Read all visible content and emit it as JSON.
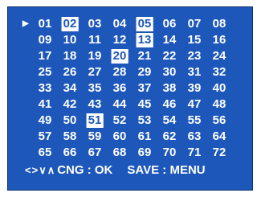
{
  "cursor_glyph": "▶",
  "channels": [
    {
      "label": "01",
      "selected": false,
      "cursor": true
    },
    {
      "label": "02",
      "selected": true
    },
    {
      "label": "03",
      "selected": false
    },
    {
      "label": "04",
      "selected": false
    },
    {
      "label": "05",
      "selected": true
    },
    {
      "label": "06",
      "selected": false
    },
    {
      "label": "07",
      "selected": false
    },
    {
      "label": "08",
      "selected": false
    },
    {
      "label": "09",
      "selected": false
    },
    {
      "label": "10",
      "selected": false
    },
    {
      "label": "11",
      "selected": false
    },
    {
      "label": "12",
      "selected": false
    },
    {
      "label": "13",
      "selected": true
    },
    {
      "label": "14",
      "selected": false
    },
    {
      "label": "15",
      "selected": false
    },
    {
      "label": "16",
      "selected": false
    },
    {
      "label": "17",
      "selected": false
    },
    {
      "label": "18",
      "selected": false
    },
    {
      "label": "19",
      "selected": false
    },
    {
      "label": "20",
      "selected": true
    },
    {
      "label": "21",
      "selected": false
    },
    {
      "label": "22",
      "selected": false
    },
    {
      "label": "23",
      "selected": false
    },
    {
      "label": "24",
      "selected": false
    },
    {
      "label": "25",
      "selected": false
    },
    {
      "label": "26",
      "selected": false
    },
    {
      "label": "27",
      "selected": false
    },
    {
      "label": "28",
      "selected": false
    },
    {
      "label": "29",
      "selected": false
    },
    {
      "label": "30",
      "selected": false
    },
    {
      "label": "31",
      "selected": false
    },
    {
      "label": "32",
      "selected": false
    },
    {
      "label": "33",
      "selected": false
    },
    {
      "label": "34",
      "selected": false
    },
    {
      "label": "35",
      "selected": false
    },
    {
      "label": "36",
      "selected": false
    },
    {
      "label": "37",
      "selected": false
    },
    {
      "label": "38",
      "selected": false
    },
    {
      "label": "39",
      "selected": false
    },
    {
      "label": "40",
      "selected": false
    },
    {
      "label": "41",
      "selected": false
    },
    {
      "label": "42",
      "selected": false
    },
    {
      "label": "43",
      "selected": false
    },
    {
      "label": "44",
      "selected": false
    },
    {
      "label": "45",
      "selected": false
    },
    {
      "label": "46",
      "selected": false
    },
    {
      "label": "47",
      "selected": false
    },
    {
      "label": "48",
      "selected": false
    },
    {
      "label": "49",
      "selected": false
    },
    {
      "label": "50",
      "selected": false
    },
    {
      "label": "51",
      "selected": true
    },
    {
      "label": "52",
      "selected": false
    },
    {
      "label": "53",
      "selected": false
    },
    {
      "label": "54",
      "selected": false
    },
    {
      "label": "55",
      "selected": false
    },
    {
      "label": "56",
      "selected": false
    },
    {
      "label": "57",
      "selected": false
    },
    {
      "label": "58",
      "selected": false
    },
    {
      "label": "59",
      "selected": false
    },
    {
      "label": "60",
      "selected": false
    },
    {
      "label": "61",
      "selected": false
    },
    {
      "label": "62",
      "selected": false
    },
    {
      "label": "63",
      "selected": false
    },
    {
      "label": "64",
      "selected": false
    },
    {
      "label": "65",
      "selected": false
    },
    {
      "label": "66",
      "selected": false
    },
    {
      "label": "67",
      "selected": false
    },
    {
      "label": "68",
      "selected": false
    },
    {
      "label": "69",
      "selected": false
    },
    {
      "label": "70",
      "selected": false
    },
    {
      "label": "71",
      "selected": false
    },
    {
      "label": "72",
      "selected": false
    }
  ],
  "footer": {
    "nav_icons": [
      "<",
      ">",
      "∨",
      "∧"
    ],
    "change_label": "CNG : OK",
    "save_label": "SAVE : MENU"
  },
  "colors": {
    "background": "#1e57ba",
    "text": "#ffffff",
    "selected_bg": "#ffffff",
    "selected_text": "#1e57ba"
  }
}
